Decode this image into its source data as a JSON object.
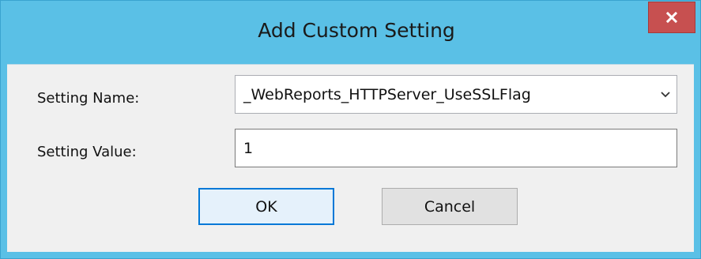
{
  "dialog": {
    "title": "Add Custom Setting"
  },
  "form": {
    "setting_name_label": "Setting Name:",
    "setting_name_value": "_WebReports_HTTPServer_UseSSLFlag",
    "setting_value_label": "Setting Value:",
    "setting_value_value": "1"
  },
  "buttons": {
    "ok_label": "OK",
    "cancel_label": "Cancel"
  },
  "colors": {
    "titlebar": "#5ac0e6",
    "close_button": "#c75050",
    "client_background": "#f0f0f0",
    "default_button_border": "#0078d7"
  },
  "icons": {
    "close": "close-icon",
    "dropdown": "chevron-down-icon"
  }
}
